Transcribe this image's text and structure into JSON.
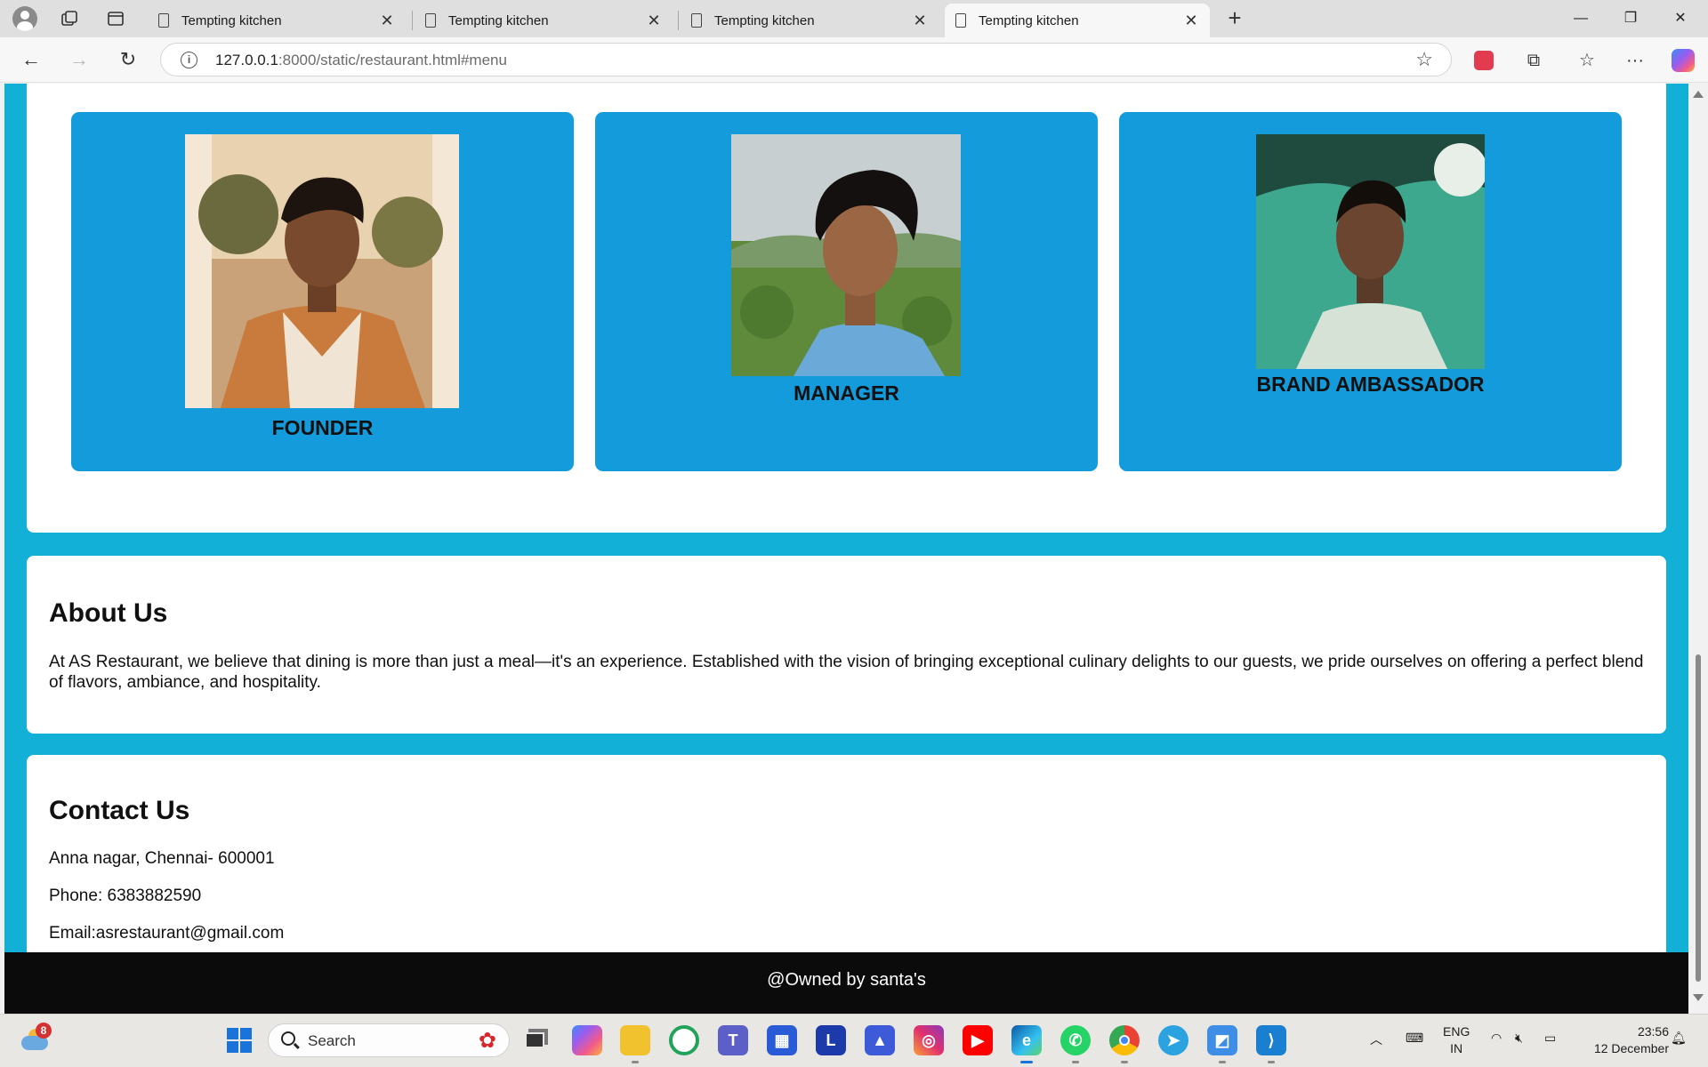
{
  "browser": {
    "tabs": [
      {
        "title": "Tempting kitchen",
        "active": false
      },
      {
        "title": "Tempting kitchen",
        "active": false
      },
      {
        "title": "Tempting kitchen",
        "active": false
      },
      {
        "title": "Tempting kitchen",
        "active": true
      }
    ],
    "url_host": "127.0.0.1",
    "url_rest": ":8000/static/restaurant.html#menu"
  },
  "team": {
    "members": [
      {
        "role": "FOUNDER"
      },
      {
        "role": "MANAGER"
      },
      {
        "role": "BRAND AMBASSADOR"
      }
    ]
  },
  "about": {
    "title": "About Us",
    "text": "At AS Restaurant, we believe that dining is more than just a meal—it's an experience. Established with the vision of bringing exceptional culinary delights to our guests, we pride ourselves on offering a perfect blend of flavors, ambiance, and hospitality."
  },
  "contact": {
    "title": "Contact Us",
    "address": "Anna nagar, Chennai- 600001",
    "phone": "Phone: 6383882590",
    "email": "Email:asrestaurant@gmail.com"
  },
  "footer": {
    "text": "@Owned by santa's"
  },
  "taskbar": {
    "weather_badge": "8",
    "search_placeholder": "Search",
    "lang_top": "ENG",
    "lang_bottom": "IN",
    "time": "23:56",
    "date": "12 December"
  },
  "colors": {
    "page_bg": "#12afd6",
    "card_bg": "#139bdb",
    "footer_bg": "#0b0b0b"
  }
}
